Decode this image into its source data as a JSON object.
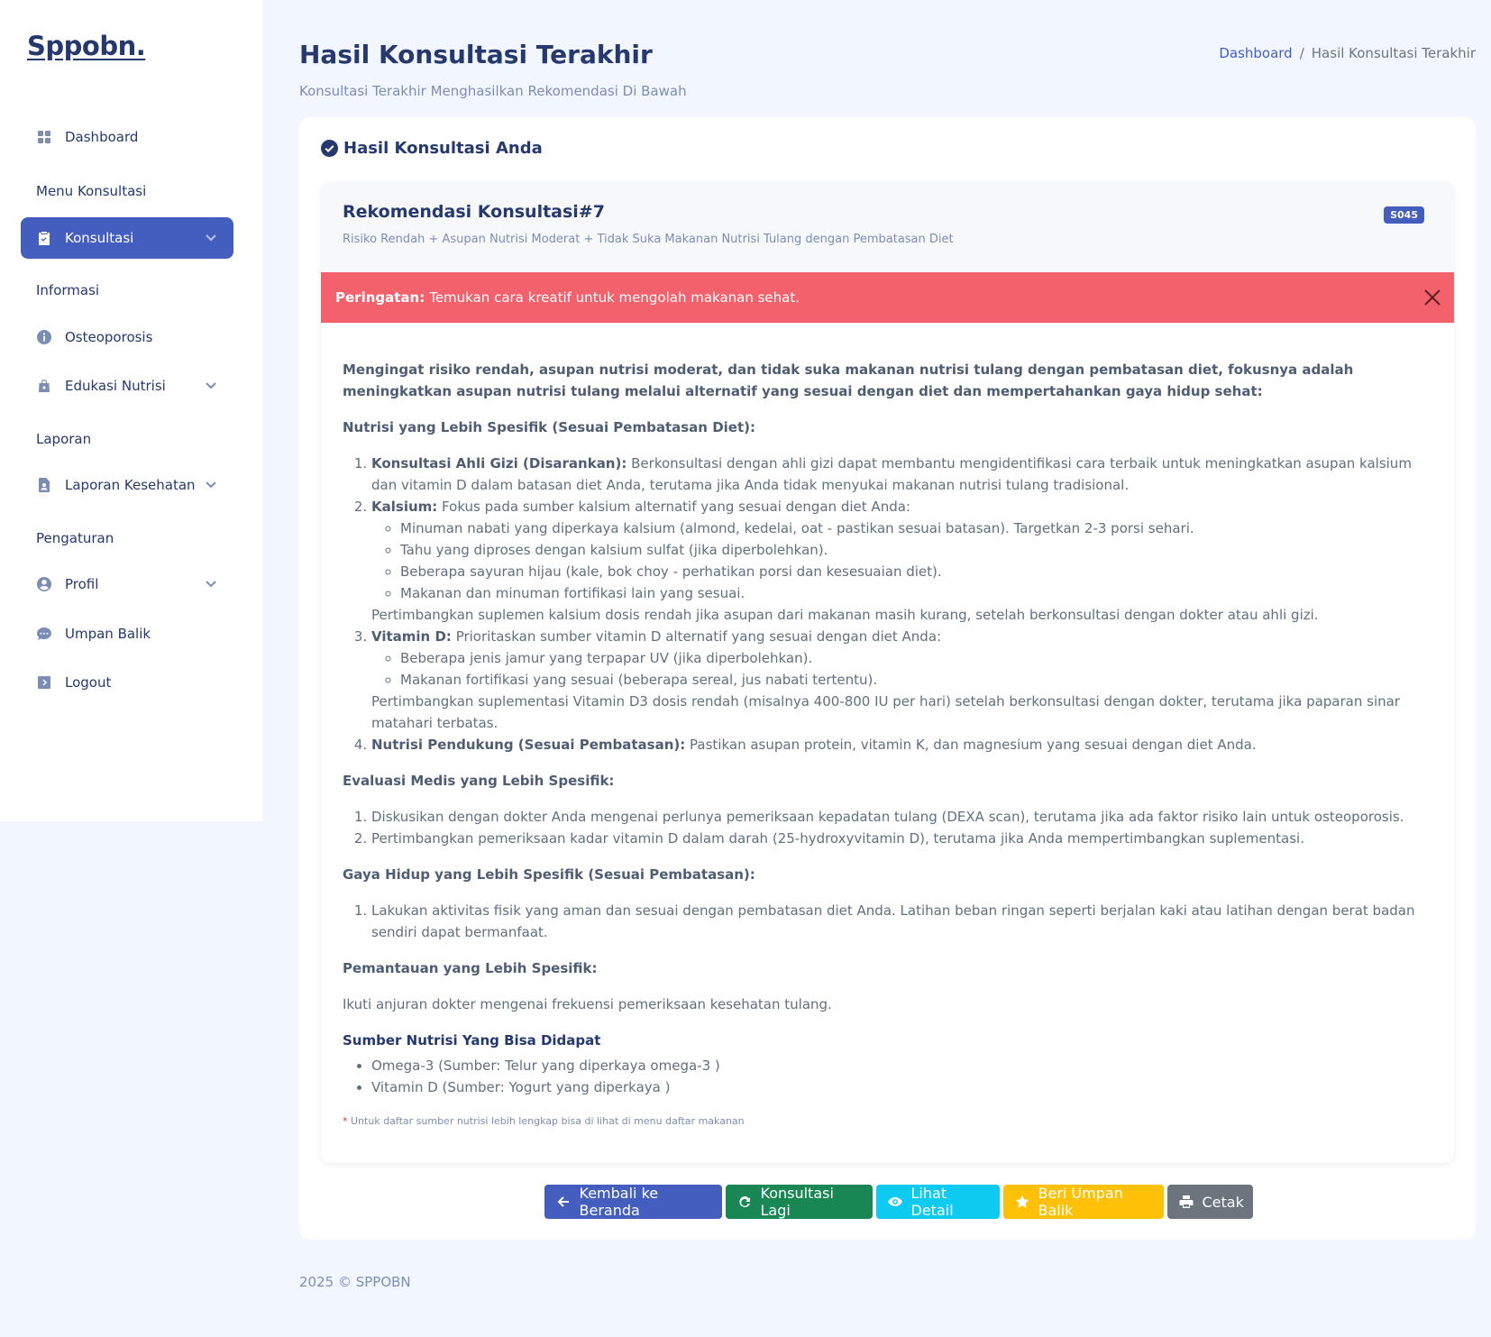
{
  "sidebar": {
    "logo": "Sppobn.",
    "dashboard": "Dashboard",
    "menu_konsultasi": "Menu Konsultasi",
    "konsultasi": "Konsultasi",
    "informasi": "Informasi",
    "osteoporosis": "Osteoporosis",
    "edukasi_nutrisi": "Edukasi Nutrisi",
    "laporan": "Laporan",
    "laporan_kesehatan": "Laporan Kesehatan",
    "pengaturan": "Pengaturan",
    "profil": "Profil",
    "umpan_balik": "Umpan Balik",
    "logout": "Logout"
  },
  "header": {
    "title": "Hasil Konsultasi Terakhir",
    "subtitle": "Konsultasi Terakhir Menghasilkan Rekomendasi Di Bawah",
    "breadcrumb_home": "Dashboard",
    "breadcrumb_sep": "/",
    "breadcrumb_current": "Hasil Konsultasi Terakhir"
  },
  "card": {
    "title": "Hasil Konsultasi Anda",
    "rek_title": "Rekomendasi Konsultasi#7",
    "rek_sub": "Risiko Rendah + Asupan Nutrisi Moderat + Tidak Suka Makanan Nutrisi Tulang dengan Pembatasan Diet",
    "badge": "S045",
    "alert_label": "Peringatan:",
    "alert_text": "Temukan cara kreatif untuk mengolah makanan sehat."
  },
  "content": {
    "lead": "Mengingat risiko rendah, asupan nutrisi moderat, dan tidak suka makanan nutrisi tulang dengan pembatasan diet, fokusnya adalah meningkatkan asupan nutrisi tulang melalui alternatif yang sesuai dengan diet dan mempertahankan gaya hidup sehat:",
    "h_nutrisi": "Nutrisi yang Lebih Spesifik (Sesuai Pembatasan Diet):",
    "n1_b": "Konsultasi Ahli Gizi (Disarankan):",
    "n1_t": "Berkonsultasi dengan ahli gizi dapat membantu mengidentifikasi cara terbaik untuk meningkatkan asupan kalsium dan vitamin D dalam batasan diet Anda, terutama jika Anda tidak menyukai makanan nutrisi tulang tradisional.",
    "n2_b": "Kalsium:",
    "n2_t": "Fokus pada sumber kalsium alternatif yang sesuai dengan diet Anda:",
    "n2_s1": "Minuman nabati yang diperkaya kalsium (almond, kedelai, oat - pastikan sesuai batasan). Targetkan 2-3 porsi sehari.",
    "n2_s2": "Tahu yang diproses dengan kalsium sulfat (jika diperbolehkan).",
    "n2_s3": "Beberapa sayuran hijau (kale, bok choy - perhatikan porsi dan kesesuaian diet).",
    "n2_s4": "Makanan dan minuman fortifikasi lain yang sesuai.",
    "n2_after": "Pertimbangkan suplemen kalsium dosis rendah jika asupan dari makanan masih kurang, setelah berkonsultasi dengan dokter atau ahli gizi.",
    "n3_b": "Vitamin D:",
    "n3_t": "Prioritaskan sumber vitamin D alternatif yang sesuai dengan diet Anda:",
    "n3_s1": "Beberapa jenis jamur yang terpapar UV (jika diperbolehkan).",
    "n3_s2": "Makanan fortifikasi yang sesuai (beberapa sereal, jus nabati tertentu).",
    "n3_after": "Pertimbangkan suplementasi Vitamin D3 dosis rendah (misalnya 400-800 IU per hari) setelah berkonsultasi dengan dokter, terutama jika paparan sinar matahari terbatas.",
    "n4_b": "Nutrisi Pendukung (Sesuai Pembatasan):",
    "n4_t": "Pastikan asupan protein, vitamin K, dan magnesium yang sesuai dengan diet Anda.",
    "h_evaluasi": "Evaluasi Medis yang Lebih Spesifik:",
    "e1": "Diskusikan dengan dokter Anda mengenai perlunya pemeriksaan kepadatan tulang (DEXA scan), terutama jika ada faktor risiko lain untuk osteoporosis.",
    "e2": "Pertimbangkan pemeriksaan kadar vitamin D dalam darah (25-hydroxyvitamin D), terutama jika Anda mempertimbangkan suplementasi.",
    "h_gaya": "Gaya Hidup yang Lebih Spesifik (Sesuai Pembatasan):",
    "g1": "Lakukan aktivitas fisik yang aman dan sesuai dengan pembatasan diet Anda. Latihan beban ringan seperti berjalan kaki atau latihan dengan berat badan sendiri dapat bermanfaat.",
    "h_pemantauan": "Pemantauan yang Lebih Spesifik:",
    "p1": "Ikuti anjuran dokter mengenai frekuensi pemeriksaan kesehatan tulang.",
    "h_sumber": "Sumber Nutrisi Yang Bisa Didapat",
    "s1": "Omega-3 (Sumber: Telur yang diperkaya omega-3 )",
    "s2": "Vitamin D (Sumber: Yogurt yang diperkaya )",
    "note_star": "*",
    "note": "Untuk daftar sumber nutrisi lebih lengkap bisa di lihat di menu daftar makanan"
  },
  "buttons": {
    "kembali": "Kembali ke Beranda",
    "konsultasi_lagi": "Konsultasi Lagi",
    "lihat_detail": "Lihat Detail",
    "umpan_balik": "Beri Umpan Balik",
    "cetak": "Cetak"
  },
  "colors": {
    "primary": "#435ebe",
    "success": "#198754",
    "info": "#0dcaf0",
    "warning": "#ffc107",
    "secondary": "#6c757d",
    "danger": "#f3616d"
  },
  "footer": "2025 © SPPOBN"
}
